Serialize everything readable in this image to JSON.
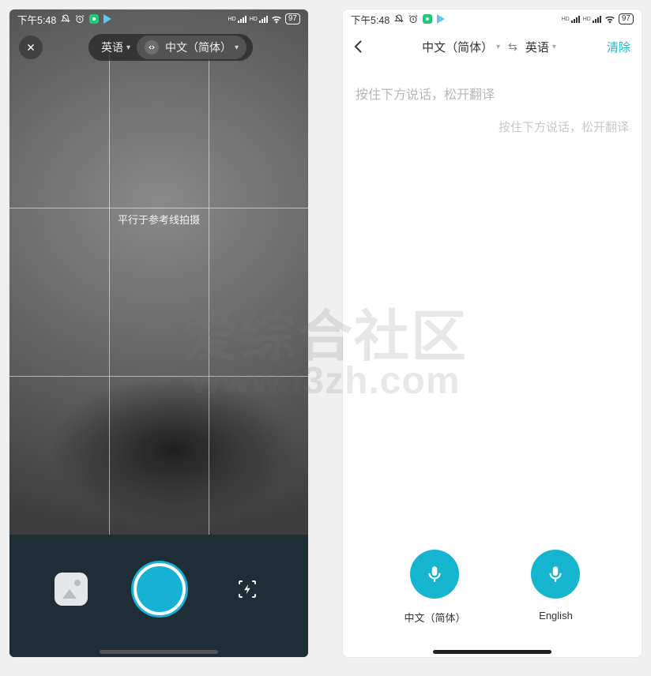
{
  "status": {
    "time": "下午5:48",
    "battery": "97"
  },
  "left": {
    "source_lang": "英语",
    "target_lang": "中文（简体）",
    "hint": "平行于参考线拍摄"
  },
  "right": {
    "source_lang": "中文（简体）",
    "target_lang": "英语",
    "clear": "清除",
    "hint_source": "按住下方说话，松开翻译",
    "hint_target": "按住下方说话，松开翻译",
    "mic1_label": "中文（简体）",
    "mic2_label": "English"
  },
  "watermark": {
    "line1": "爱综合社区",
    "line2": "www.i3zh.com"
  }
}
